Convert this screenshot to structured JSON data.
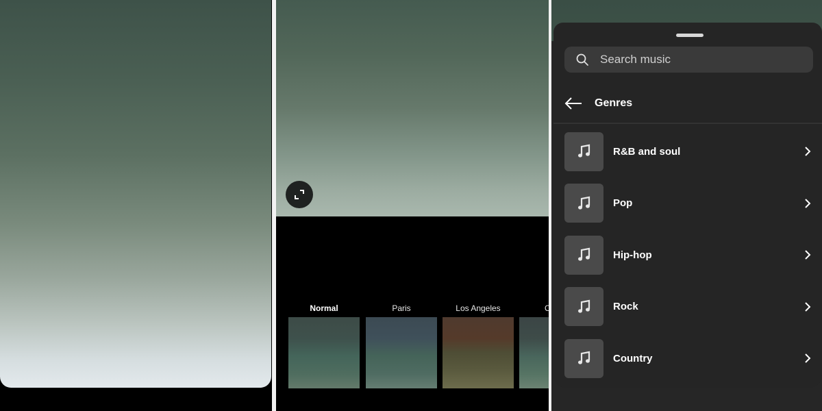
{
  "panel1": {
    "photo_description": "green-to-white gradient photo preview"
  },
  "panel2": {
    "expand_button_icon": "expand-icon",
    "filters": [
      {
        "label": "Normal",
        "selected": true
      },
      {
        "label": "Paris",
        "selected": false
      },
      {
        "label": "Los Angeles",
        "selected": false
      },
      {
        "label": "O",
        "selected": false
      }
    ]
  },
  "panel3": {
    "search": {
      "icon": "search-icon",
      "placeholder": "Search music"
    },
    "header": {
      "back_icon": "arrow-left-icon",
      "title": "Genres"
    },
    "genres": [
      {
        "label": "R&B and soul",
        "icon": "music-note-icon"
      },
      {
        "label": "Pop",
        "icon": "music-note-icon"
      },
      {
        "label": "Hip-hop",
        "icon": "music-note-icon"
      },
      {
        "label": "Rock",
        "icon": "music-note-icon"
      },
      {
        "label": "Country",
        "icon": "music-note-icon"
      }
    ]
  },
  "colors": {
    "sheet_bg": "#252525",
    "search_bg": "#3a3a3a",
    "thumb_bg": "#4a4a4a",
    "text": "#ffffff"
  }
}
